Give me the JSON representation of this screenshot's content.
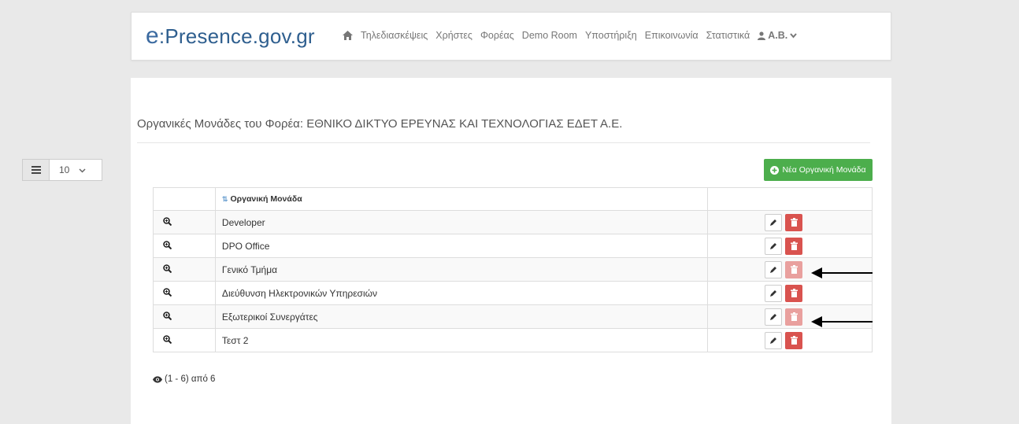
{
  "brand": {
    "logo_prefix": "e",
    "logo_rest": ":Presence.gov.gr"
  },
  "nav": {
    "items": [
      "Τηλεδιασκέψεις",
      "Χρήστες",
      "Φορέας",
      "Demo Room",
      "Υποστήριξη",
      "Επικοινωνία",
      "Στατιστικά"
    ],
    "user": "Α.Β."
  },
  "page": {
    "title": "Οργανικές Μονάδες του Φορέα: ΕΘΝΙΚΟ ΔΙΚΤΥΟ ΕΡΕΥΝΑΣ ΚΑΙ ΤΕΧΝΟΛΟΓΙΑΣ ΕΔΕΤ Α.Ε.",
    "page_size": "10",
    "new_button": "Νέα Οργανική Μονάδα"
  },
  "table": {
    "header": "Οργανική Μονάδα",
    "rows": [
      {
        "name": "Developer",
        "delete_enabled": true
      },
      {
        "name": "DPO Office",
        "delete_enabled": true
      },
      {
        "name": "Γενικό Τμήμα",
        "delete_enabled": false
      },
      {
        "name": "Διεύθυνση Ηλεκτρονικών Υπηρεσιών",
        "delete_enabled": true
      },
      {
        "name": "Εξωτερικοί Συνεργάτες",
        "delete_enabled": false
      },
      {
        "name": "Τεστ 2",
        "delete_enabled": true
      }
    ]
  },
  "pagination": {
    "summary": "(1 - 6) από 6"
  },
  "colors": {
    "brand_blue": "#2f5f8f",
    "success": "#4cae4c",
    "danger": "#d9534f",
    "danger_disabled": "#e9a09e"
  }
}
